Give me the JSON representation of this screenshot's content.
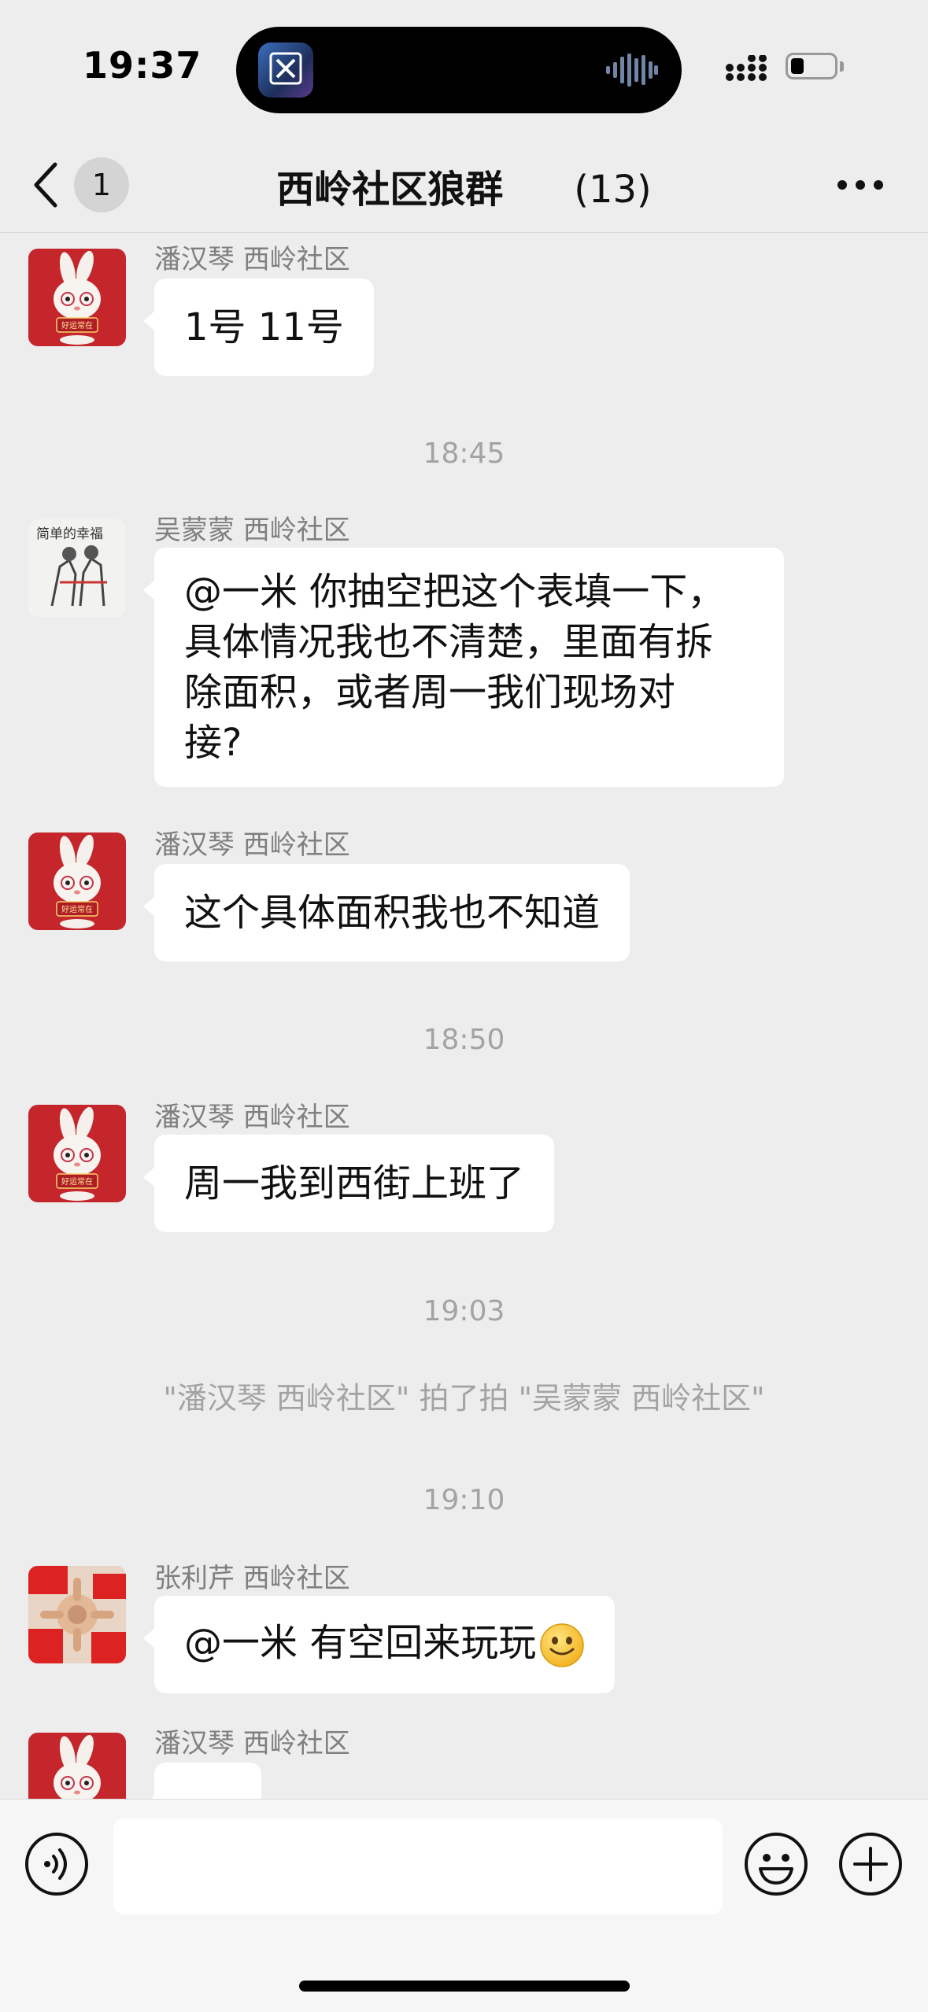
{
  "status_bar": {
    "time": "19:37"
  },
  "nav": {
    "unread_count": "1",
    "title": "西岭社区狼群",
    "member_count": "(13)"
  },
  "messages": [
    {
      "sender": "潘汉琴 西岭社区",
      "text": "1号 11号",
      "avatar": "bunny-avatar"
    },
    {
      "timestamp": "18:45"
    },
    {
      "sender": "吴蒙蒙 西岭社区",
      "lines": [
        "@一米 你抽空把这个表填一下，",
        "具体情况我也不清楚，里面有拆",
        "除面积，或者周一我们现场对",
        "接?"
      ],
      "avatar": "sketch-avatar",
      "avatar_caption": "简单的幸福"
    },
    {
      "sender": "潘汉琴 西岭社区",
      "text": "这个具体面积我也不知道",
      "avatar": "bunny-avatar"
    },
    {
      "timestamp": "18:50"
    },
    {
      "sender": "潘汉琴 西岭社区",
      "text": "周一我到西街上班了",
      "avatar": "bunny-avatar"
    },
    {
      "timestamp": "19:03"
    },
    {
      "system": "\"潘汉琴 西岭社区\" 拍了拍 \"吴蒙蒙 西岭社区\""
    },
    {
      "timestamp": "19:10"
    },
    {
      "sender": "张利芹 西岭社区",
      "text": "@一米 有空回来玩玩",
      "emoji": "smile-emoji",
      "avatar": "hands-avatar"
    },
    {
      "sender": "潘汉琴 西岭社区",
      "text": "",
      "avatar": "bunny-avatar"
    }
  ],
  "bunny_caption": "好运常在",
  "colors": {
    "bubble": "#ffffff",
    "background": "#ededed",
    "meta_text": "#a3a3a3",
    "bunny_bg": "#c4262c"
  },
  "icons": [
    "back-chevron-icon",
    "more-icon",
    "voice-icon",
    "emoji-icon",
    "plus-icon",
    "signal-icon",
    "battery-icon"
  ]
}
